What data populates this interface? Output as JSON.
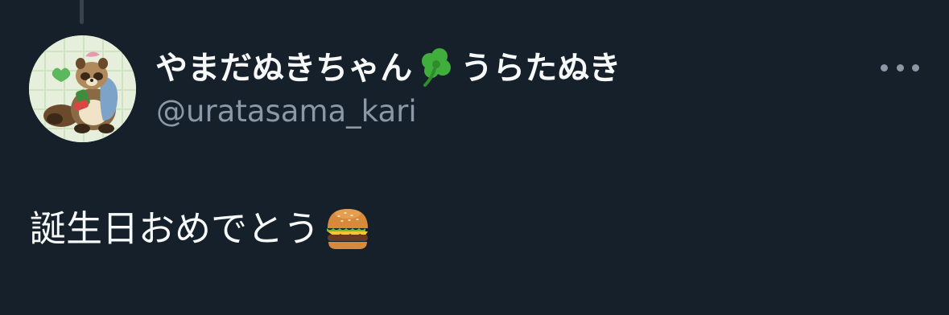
{
  "tweet": {
    "author": {
      "display_name": "やまだぬきちゃん",
      "display_name_suffix": "うらたぬき",
      "name_emoji": "shamrock-icon",
      "handle": "@uratasama_kari",
      "avatar": "tanuki-avatar"
    },
    "more_menu": "more-options-icon",
    "body": {
      "text": "誕生日おめでとう",
      "emoji": "hamburger-icon"
    }
  },
  "colors": {
    "background": "#15202b",
    "primary_text": "#f7f9f9",
    "secondary_text": "#8b98a5",
    "thread_line": "#38444d"
  }
}
